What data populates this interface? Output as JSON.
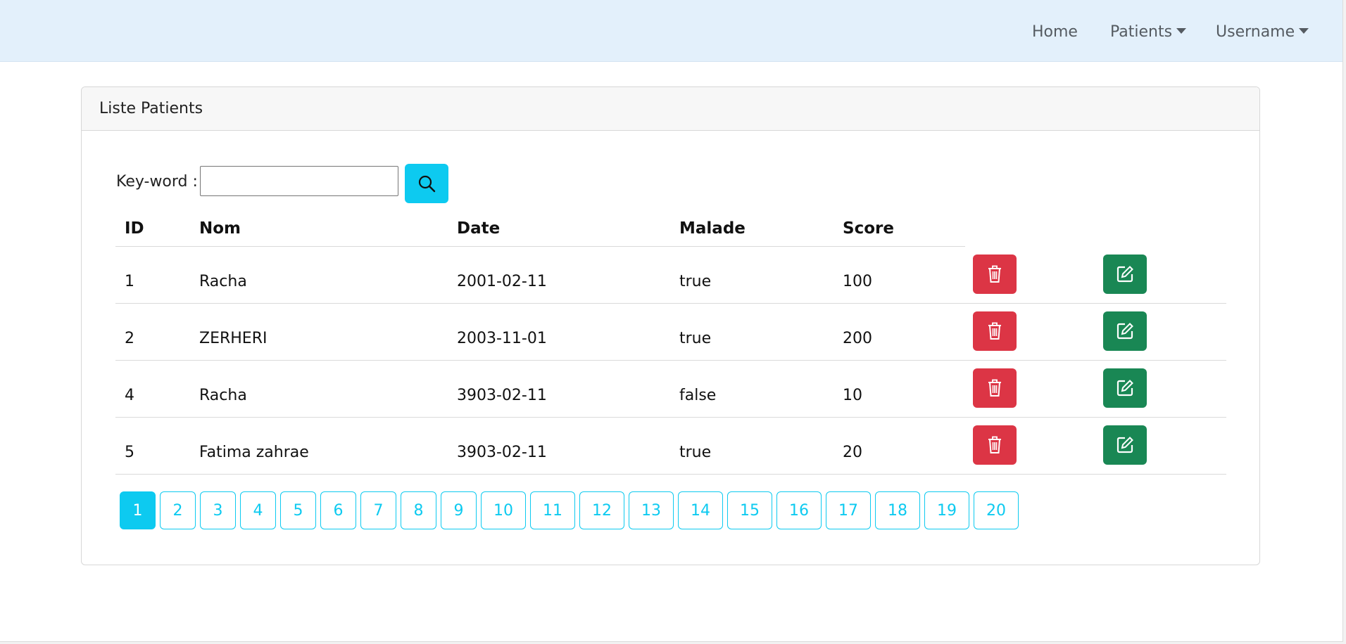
{
  "navbar": {
    "home_label": "Home",
    "patients_label": "Patients",
    "username_label": "Username"
  },
  "card": {
    "title": "Liste Patients"
  },
  "search": {
    "label": "Key-word :",
    "value": "",
    "button_icon": "search-icon"
  },
  "table": {
    "headers": [
      "ID",
      "Nom",
      "Date",
      "Malade",
      "Score"
    ],
    "rows": [
      {
        "id": "1",
        "nom": "Racha",
        "date": "2001-02-11",
        "malade": "true",
        "score": "100"
      },
      {
        "id": "2",
        "nom": "ZERHERI",
        "date": "2003-11-01",
        "malade": "true",
        "score": "200"
      },
      {
        "id": "4",
        "nom": "Racha",
        "date": "3903-02-11",
        "malade": "false",
        "score": "10"
      },
      {
        "id": "5",
        "nom": "Fatima zahrae",
        "date": "3903-02-11",
        "malade": "true",
        "score": "20"
      }
    ],
    "delete_icon": "trash-icon",
    "edit_icon": "pencil-square-icon"
  },
  "pagination": {
    "pages": [
      "1",
      "2",
      "3",
      "4",
      "5",
      "6",
      "7",
      "8",
      "9",
      "10",
      "11",
      "12",
      "13",
      "14",
      "15",
      "16",
      "17",
      "18",
      "19",
      "20"
    ],
    "current": "1"
  },
  "colors": {
    "navbar_bg": "#e3f0fb",
    "info": "#0dcaf0",
    "danger": "#dc3545",
    "success": "#198754"
  }
}
